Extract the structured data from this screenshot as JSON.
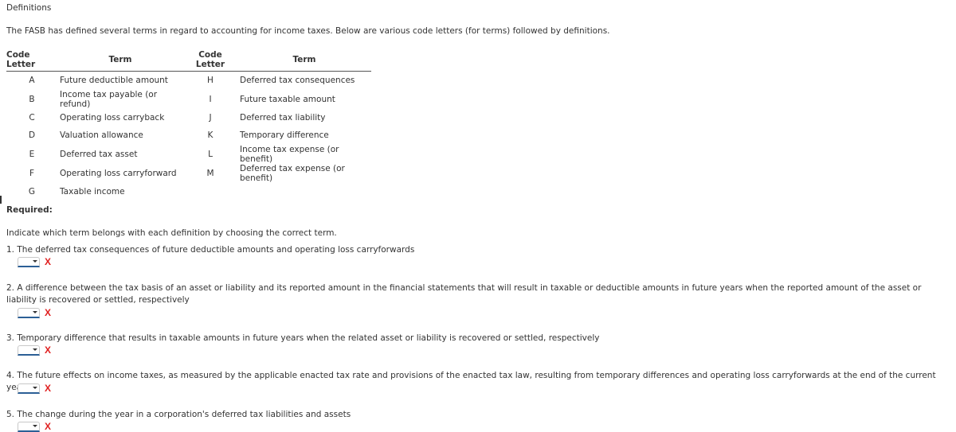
{
  "section_title": "Definitions",
  "intro": "The FASB has defined several terms in regard to accounting for income taxes. Below are various code letters (for terms) followed by definitions.",
  "table": {
    "headers": [
      "Code Letter",
      "Term",
      "Code Letter",
      "Term"
    ],
    "rows": [
      {
        "code1": "A",
        "term1": "Future deductible amount",
        "code2": "H",
        "term2": "Deferred tax consequences"
      },
      {
        "code1": "B",
        "term1": "Income tax payable (or refund)",
        "code2": "I",
        "term2": "Future taxable amount"
      },
      {
        "code1": "C",
        "term1": "Operating loss carryback",
        "code2": "J",
        "term2": "Deferred tax liability"
      },
      {
        "code1": "D",
        "term1": "Valuation allowance",
        "code2": "K",
        "term2": "Temporary difference"
      },
      {
        "code1": "E",
        "term1": "Deferred tax asset",
        "code2": "L",
        "term2": "Income tax expense (or benefit)"
      },
      {
        "code1": "F",
        "term1": "Operating loss carryforward",
        "code2": "M",
        "term2": "Deferred tax expense (or benefit)"
      },
      {
        "code1": "G",
        "term1": "Taxable income",
        "code2": "",
        "term2": ""
      }
    ]
  },
  "required_label": "Required:",
  "instruction": "Indicate which term belongs with each definition by choosing the correct term.",
  "questions": [
    {
      "number": "1.",
      "text": "The deferred tax consequences of future deductible amounts and operating loss carryforwards",
      "selected": "",
      "status_icon": "x-icon",
      "status_mark": "X"
    },
    {
      "number": "2.",
      "text": "A difference between the tax basis of an asset or liability and its reported amount in the financial statements that will result in taxable or deductible amounts in future years when the reported amount of the asset or liability is recovered or settled, respectively",
      "selected": "",
      "status_icon": "x-icon",
      "status_mark": "X"
    },
    {
      "number": "3.",
      "text": "Temporary difference that results in taxable amounts in future years when the related asset or liability is recovered or settled, respectively",
      "selected": "",
      "status_icon": "x-icon",
      "status_mark": "X"
    },
    {
      "number": "4.",
      "text": "The future effects on income taxes, as measured by the applicable enacted tax rate and provisions of the enacted tax law, resulting from temporary differences and operating loss carryforwards at the end of the current year",
      "selected": "",
      "status_icon": "x-icon",
      "status_mark": "X"
    },
    {
      "number": "5.",
      "text": "The change during the year in a corporation's deferred tax liabilities and assets",
      "selected": "",
      "status_icon": "x-icon",
      "status_mark": "X"
    }
  ],
  "colors": {
    "incorrect_mark": "#e02020",
    "select_underline": "#2b5f96"
  }
}
